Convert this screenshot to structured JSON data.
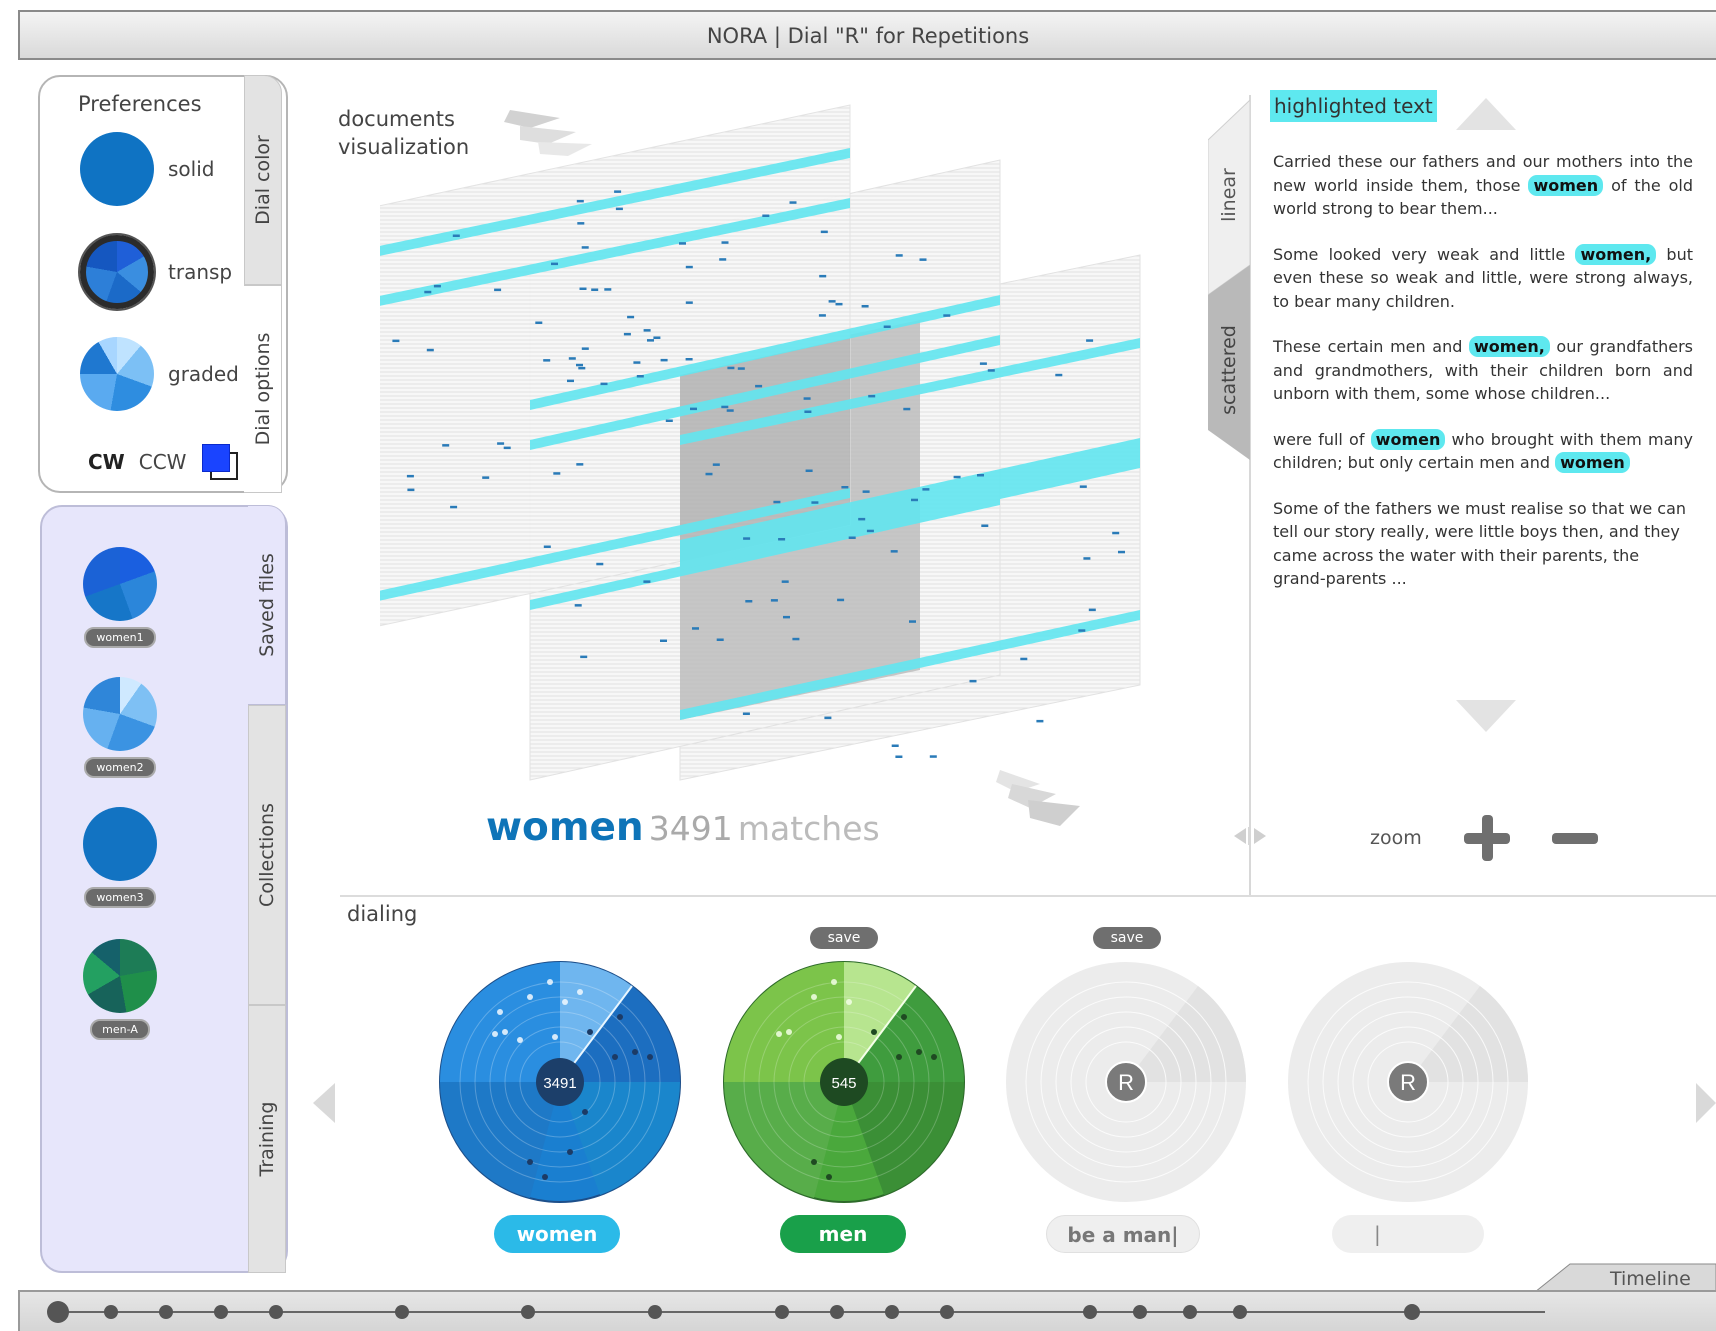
{
  "window": {
    "title": "NORA | Dial \"R\" for Repetitions"
  },
  "preferences": {
    "heading": "Preferences",
    "tabs": {
      "dial_color": "Dial color",
      "dial_options": "Dial options"
    },
    "options": [
      {
        "label": "solid",
        "icon": "dial-solid-icon"
      },
      {
        "label": "transp",
        "icon": "dial-transparent-icon"
      },
      {
        "label": "graded",
        "icon": "dial-graded-icon"
      }
    ],
    "direction": {
      "cw": "CW",
      "ccw": "CCW"
    },
    "color_picker": {
      "icon": "color-picker-icon",
      "color": "#1a44ff"
    }
  },
  "saved_panel": {
    "tabs": {
      "saved_files": "Saved files",
      "collections": "Collections",
      "training": "Training"
    },
    "files": [
      {
        "label": "women1",
        "color": "#1b7fd0"
      },
      {
        "label": "women2",
        "color": "#5aa3e6"
      },
      {
        "label": "women3",
        "color": "#0f72bf"
      },
      {
        "label": "men-A",
        "color": "#1f8a52"
      }
    ]
  },
  "visualization": {
    "label_line1": "documents",
    "label_line2": "visualization",
    "term": "women",
    "match_count": "3491",
    "match_unit": "matches"
  },
  "text_panel": {
    "modes": {
      "linear": "linear",
      "scattered": "scattered"
    },
    "title": "highlighted text",
    "paragraphs": [
      {
        "before": "Carried these our fathers and our mothers into the new world inside them, those ",
        "term": "women",
        "after": " of the old world strong to bear them..."
      },
      {
        "before": "Some looked very weak and little ",
        "term": "women,",
        "after": " but even these so weak and little, were strong always, to bear many children."
      },
      {
        "before": "These certain men and ",
        "term": "women,",
        "after": " our grandfathers and grandmothers, with their children born and unborn with them, some whose children..."
      },
      {
        "before": "were full of ",
        "term": "women",
        "after": " who brought with them many children; but only certain men and ",
        "term2": "women"
      },
      {
        "before": "Some of the fathers we must realise so that we can tell our story really, were little boys then, and they came across the water with their parents, the grand-parents ..."
      }
    ],
    "zoom_label": "zoom"
  },
  "dialing": {
    "label": "dialing",
    "save_label": "save",
    "dials": [
      {
        "count": "3491",
        "term": "women",
        "color": "#1a7fd0"
      },
      {
        "count": "545",
        "term": "men",
        "color": "#4aa83c"
      },
      {
        "count": "R",
        "term": "be a man|",
        "color": "#e9e9e9"
      },
      {
        "count": "R",
        "term": "|",
        "color": "#e9e9e9"
      }
    ]
  },
  "timeline": {
    "label": "Timeline"
  },
  "colors": {
    "highlight": "#5ee8ef",
    "accent_blue": "#0e74b8",
    "accent_green": "#19a04a"
  }
}
